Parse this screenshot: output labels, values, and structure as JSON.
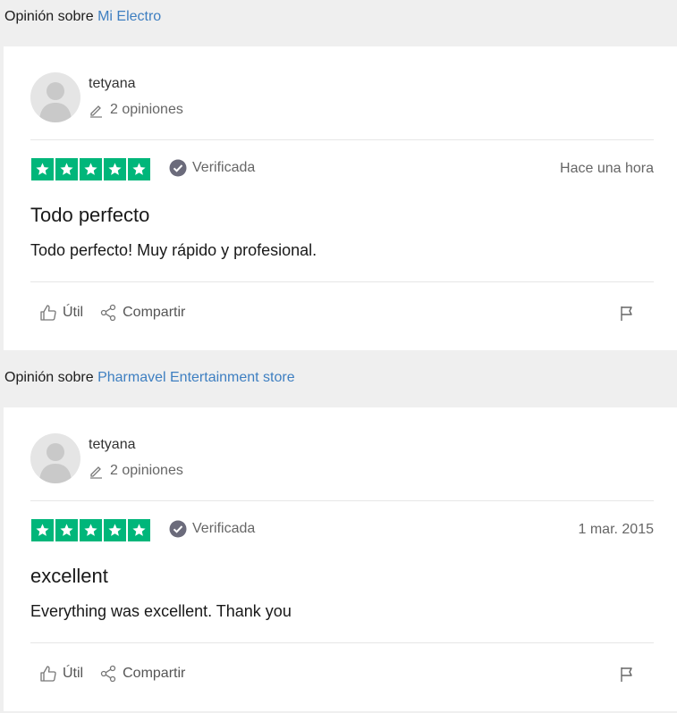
{
  "reviews": [
    {
      "header_prefix": "Opinión sobre",
      "company": "Mi Electro",
      "user": "tetyana",
      "reviews_count": "2 opiniones",
      "rating": 5,
      "verified_label": "Verificada",
      "date": "Hace una hora",
      "title": "Todo perfecto",
      "body": "Todo perfecto! Muy rápido y profesional.",
      "useful_label": "Útil",
      "share_label": "Compartir"
    },
    {
      "header_prefix": "Opinión sobre",
      "company": "Pharmavel Entertainment store",
      "user": "tetyana",
      "reviews_count": "2 opiniones",
      "rating": 5,
      "verified_label": "Verificada",
      "date": "1 mar. 2015",
      "title": "excellent",
      "body": "Everything was excellent. Thank you",
      "useful_label": "Útil",
      "share_label": "Compartir"
    }
  ],
  "colors": {
    "star_green": "#00b67a",
    "link_blue": "#3e7fc1",
    "page_bg": "#efefef"
  }
}
